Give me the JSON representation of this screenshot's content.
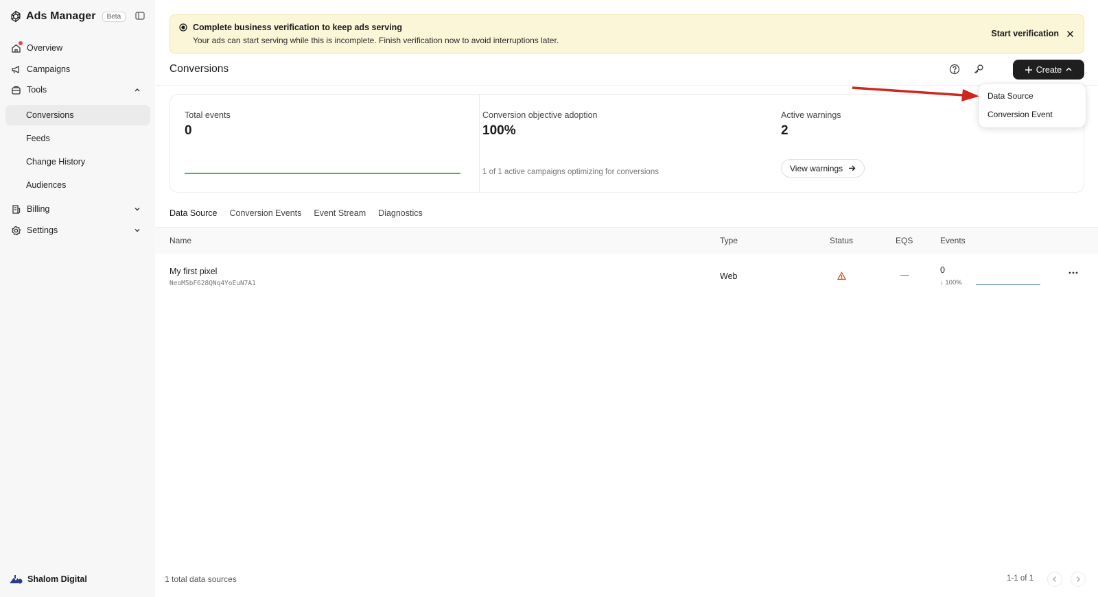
{
  "sidebar": {
    "brand": "Ads Manager",
    "beta": "Beta",
    "items": [
      {
        "label": "Overview"
      },
      {
        "label": "Campaigns"
      },
      {
        "label": "Tools"
      },
      {
        "label": "Conversions"
      },
      {
        "label": "Feeds"
      },
      {
        "label": "Change History"
      },
      {
        "label": "Audiences"
      },
      {
        "label": "Billing"
      },
      {
        "label": "Settings"
      }
    ],
    "workspace": "Shalom Digital"
  },
  "banner": {
    "title": "Complete business verification to keep ads serving",
    "description": "Your ads can start serving while this is incomplete. Finish verification now to avoid interruptions later.",
    "action": "Start verification"
  },
  "header": {
    "title": "Conversions",
    "create_label": "Create"
  },
  "stats": [
    {
      "label": "Total events",
      "value": "0"
    },
    {
      "label": "Conversion objective adoption",
      "value": "100%",
      "sub": "1 of 1 active campaigns optimizing for conversions"
    },
    {
      "label": "Active warnings",
      "value": "2",
      "action": "View warnings"
    }
  ],
  "tabs": [
    {
      "label": "Data Source"
    },
    {
      "label": "Conversion Events"
    },
    {
      "label": "Event Stream"
    },
    {
      "label": "Diagnostics"
    }
  ],
  "table": {
    "columns": [
      "Name",
      "Type",
      "Status",
      "EQS",
      "Events"
    ],
    "rows": [
      {
        "name": "My first pixel",
        "id": "NeoM5bF628QNq4YoEuN7A1",
        "type": "Web",
        "eqs": "—",
        "events": "0",
        "change": "↓ 100%"
      }
    ]
  },
  "footer": {
    "count": "1 total data sources",
    "pager": "1-1 of 1"
  },
  "dropdown": {
    "items": [
      "Data Source",
      "Conversion Event"
    ]
  },
  "colors": {
    "banner_bg": "#fcf6d9",
    "primary_button": "#1f1f1f",
    "annotation_arrow": "#d0271d",
    "spark_green": "#3dbb57",
    "spark_blue": "#3b6fd4"
  }
}
